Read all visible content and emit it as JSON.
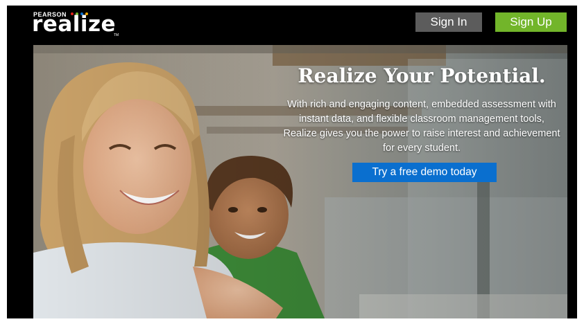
{
  "header": {
    "logo": {
      "brand": "PEARSON",
      "product": "realize",
      "trademark": "TM",
      "dot_colors": [
        "#e2231a",
        "#72b52a",
        "#0a6fcf",
        "#f5a800"
      ]
    },
    "sign_in_label": "Sign In",
    "sign_up_label": "Sign Up"
  },
  "hero": {
    "title": "Realize Your Potential.",
    "description": "With rich and engaging content, embedded assessment with instant data, and flexible classroom management tools, Realize gives you the power to raise interest and achievement for every student.",
    "demo_button_label": "Try a free demo today"
  },
  "colors": {
    "background": "#000000",
    "sign_in_bg": "#5c5c5c",
    "sign_up_bg": "#72b52a",
    "demo_button_bg": "#0a6fcf"
  }
}
